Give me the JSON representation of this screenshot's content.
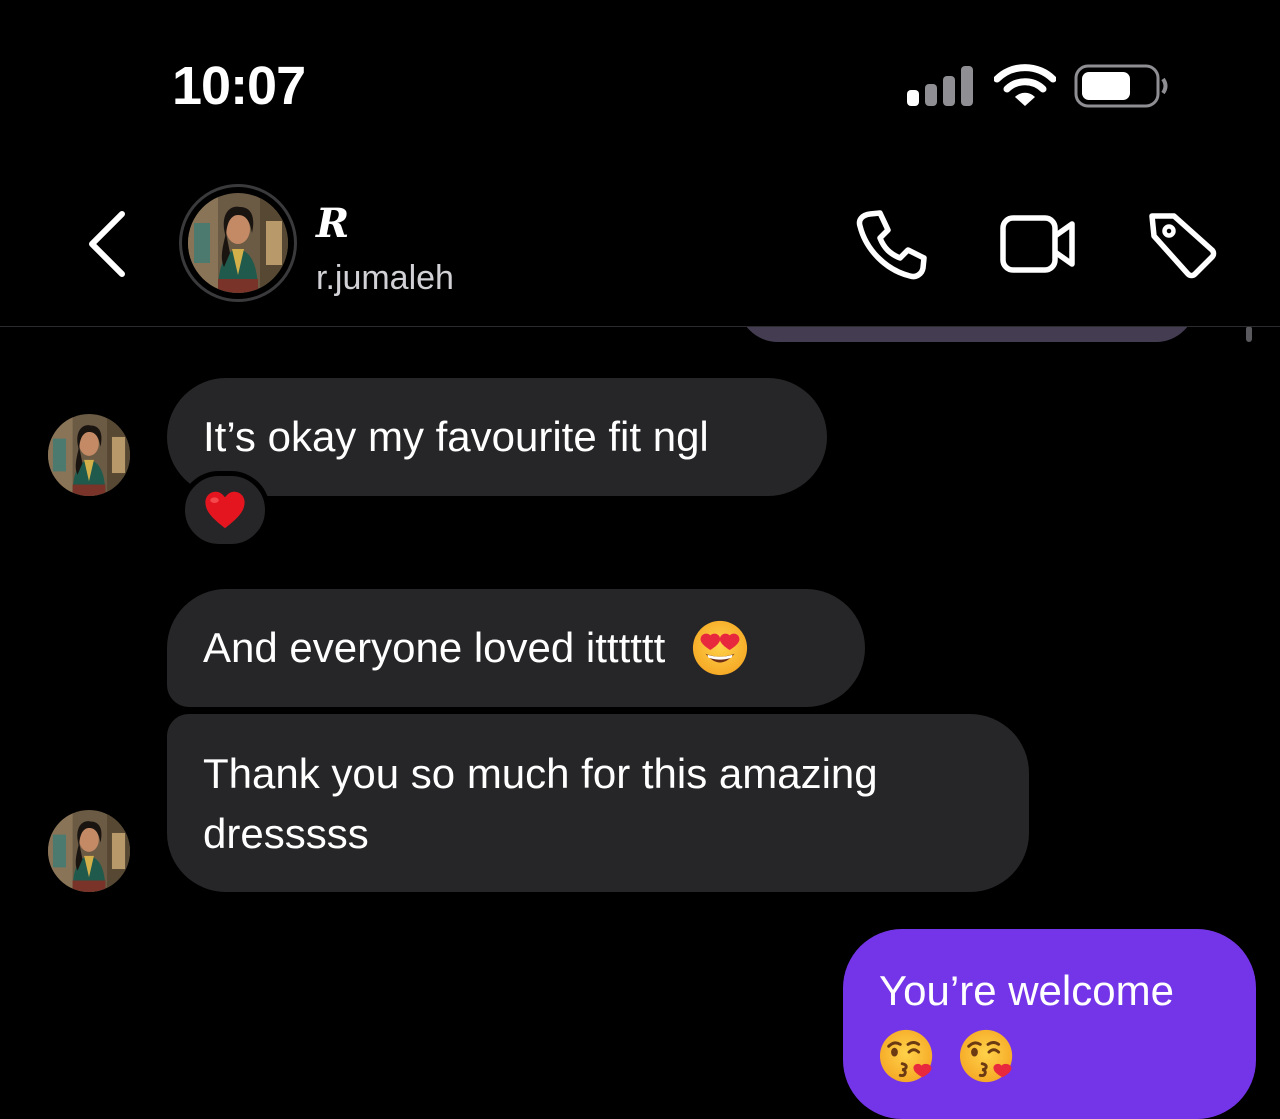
{
  "status_bar": {
    "time": "10:07"
  },
  "header": {
    "display_name": "R",
    "username": "r.jumaleh",
    "icons": [
      "back-chevron-icon",
      "phone-icon",
      "video-camera-icon",
      "tag-icon"
    ]
  },
  "messages": [
    {
      "from": "them",
      "text": "It’s okay my favourite fit ngl",
      "reaction": "red-heart-emoji"
    },
    {
      "from": "them",
      "text": "And everyone loved itttttt",
      "emoji": [
        "heart-eyes-emoji"
      ]
    },
    {
      "from": "them",
      "lines": [
        "Thank you so much for this amazing",
        "dresssss"
      ]
    },
    {
      "from": "me",
      "text": "You’re welcome",
      "emoji": [
        "kissing-heart-emoji",
        "kissing-heart-emoji"
      ]
    }
  ],
  "colors": {
    "background": "#000000",
    "incoming_bubble": "#262628",
    "outgoing_bubble": "#7435e8",
    "text": "#ffffff",
    "secondary_text": "#d1d1d6"
  }
}
